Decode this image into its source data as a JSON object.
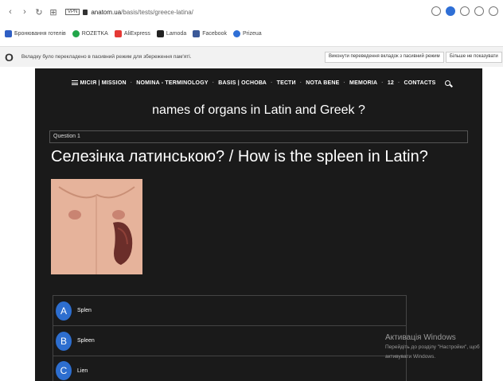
{
  "browser": {
    "url_host": "anatom.ua",
    "url_path": "/basis/tests/greece-latina/",
    "vpn_label": "VPN"
  },
  "bookmarks": [
    {
      "label": "Бронювання готелів",
      "color": "#2f5fc4"
    },
    {
      "label": "ROZETKA",
      "color": "#22a64a"
    },
    {
      "label": "AliExpress",
      "color": "#e53935"
    },
    {
      "label": "Lamoda",
      "color": "#222222"
    },
    {
      "label": "Facebook",
      "color": "#3b5998"
    },
    {
      "label": "Prizeua",
      "color": "#2f6fd6"
    }
  ],
  "translation_bar": {
    "message": "Вкладку було перекладено в пасивний режим для збереження пам'яті.",
    "button_wake": "Виконути переведення вкладок з пасивний режим",
    "button_hide": "Більше не показувати"
  },
  "site_nav": {
    "items": [
      "МІСІЯ | MISSION",
      "NOMINA - TERMINOLOGY",
      "BASIS | ОСНОВА",
      "ТЕСТИ",
      "NOTA BENE",
      "MEMORIA",
      "12",
      "CONTACTS"
    ]
  },
  "main": {
    "title": "names of organs in Latin and Greek ?",
    "question_label": "Question 1",
    "question_text": "Селезінка латинською?  / How is the spleen in Latin?"
  },
  "answers": [
    {
      "letter": "A",
      "text": "Splen"
    },
    {
      "letter": "B",
      "text": "Spleen"
    },
    {
      "letter": "C",
      "text": "Lien"
    }
  ],
  "windows_activation": {
    "title": "Активація Windows",
    "line1": "Перейдіть до розділу \"Настройки\", щоб",
    "line2": "активувати Windows."
  },
  "colors": {
    "accent": "#2d6ecf",
    "site_bg": "#1a1a1a"
  }
}
